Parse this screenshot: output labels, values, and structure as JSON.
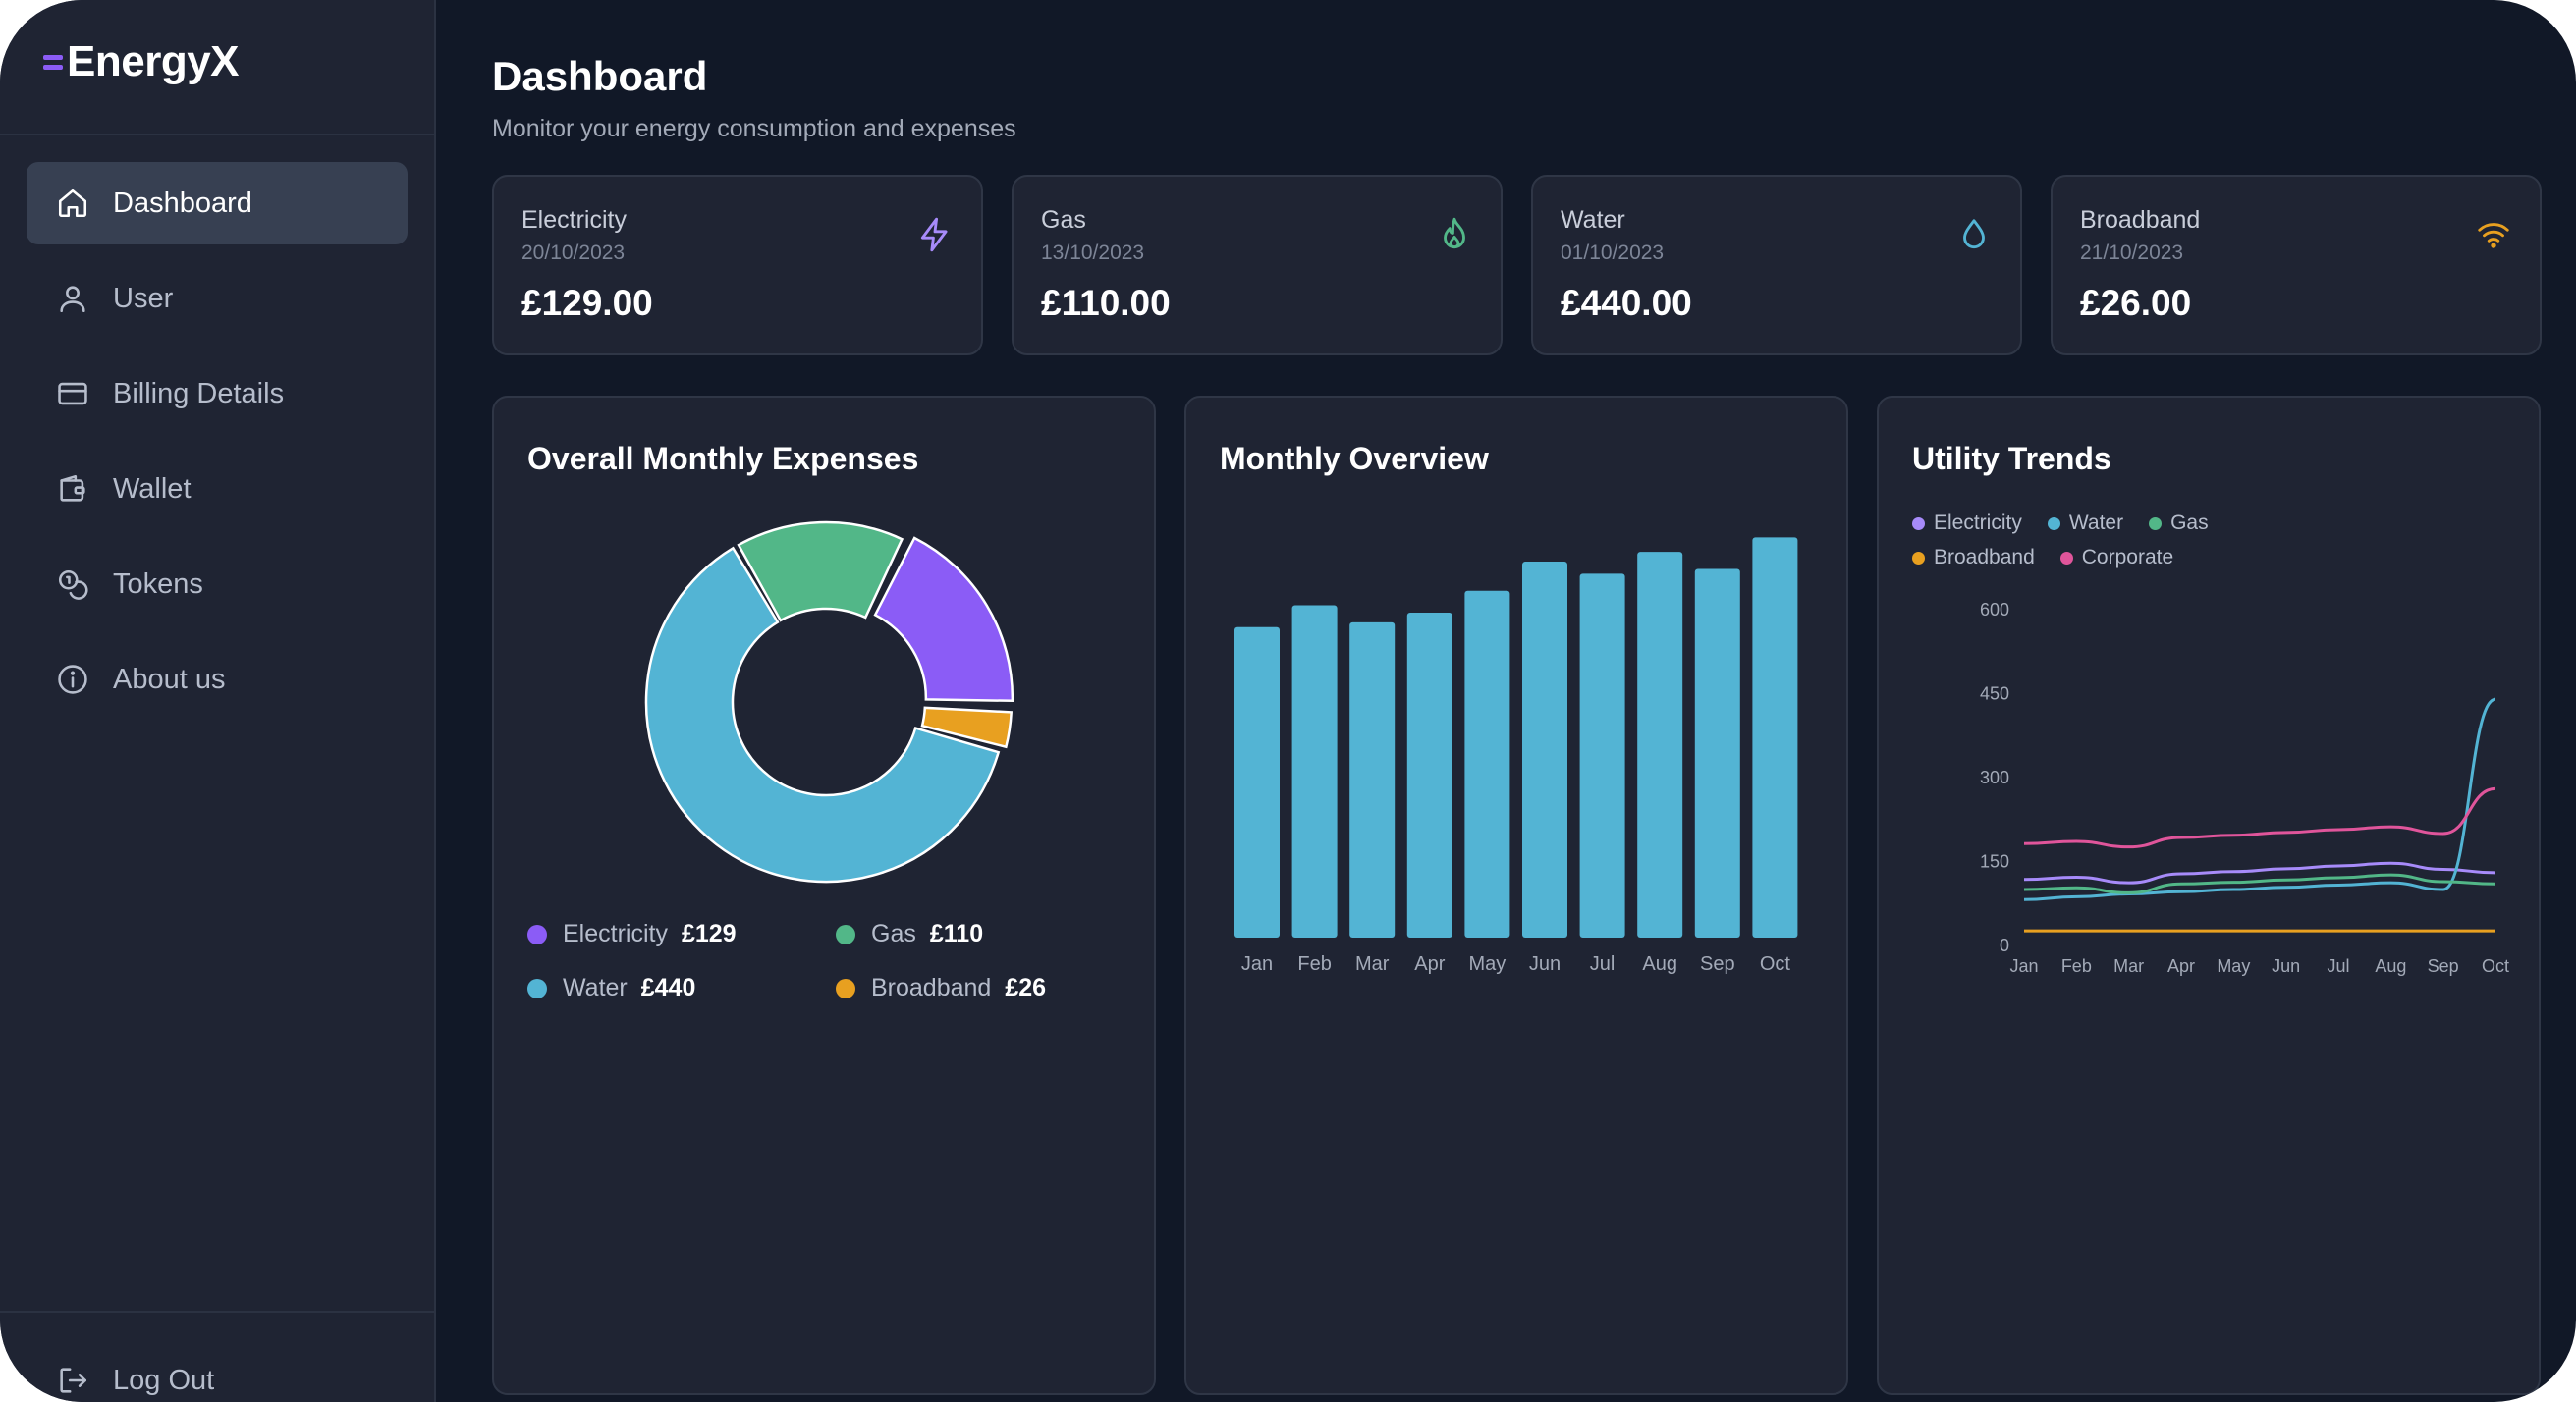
{
  "app": {
    "brand": "EnergyX"
  },
  "colors": {
    "electricity": "#8b5cf6",
    "water": "#53b4d4",
    "gas": "#52b788",
    "broadband": "#e8a020",
    "corporate": "#e0559b",
    "bar": "#53b4d4",
    "background": "#111827",
    "panel": "#1f2433"
  },
  "sidebar": {
    "items": [
      {
        "label": "Dashboard",
        "icon": "home-icon",
        "active": true
      },
      {
        "label": "User",
        "icon": "user-icon",
        "active": false
      },
      {
        "label": "Billing Details",
        "icon": "credit-card-icon",
        "active": false
      },
      {
        "label": "Wallet",
        "icon": "wallet-icon",
        "active": false
      },
      {
        "label": "Tokens",
        "icon": "coins-icon",
        "active": false
      },
      {
        "label": "About us",
        "icon": "info-icon",
        "active": false
      }
    ],
    "logout": {
      "label": "Log Out",
      "icon": "logout-icon"
    }
  },
  "header": {
    "title": "Dashboard",
    "subtitle": "Monitor your energy consumption and expenses"
  },
  "cards": [
    {
      "label": "Electricity",
      "date": "20/10/2023",
      "amount": "£129.00",
      "icon": "lightning-icon"
    },
    {
      "label": "Gas",
      "date": "13/10/2023",
      "amount": "£110.00",
      "icon": "flame-icon"
    },
    {
      "label": "Water",
      "date": "01/10/2023",
      "amount": "£440.00",
      "icon": "droplet-icon"
    },
    {
      "label": "Broadband",
      "date": "21/10/2023",
      "amount": "£26.00",
      "icon": "wifi-icon"
    }
  ],
  "panels": {
    "expenses": {
      "title": "Overall Monthly Expenses"
    },
    "overview": {
      "title": "Monthly Overview"
    },
    "trends": {
      "title": "Utility Trends"
    }
  },
  "chart_data": [
    {
      "type": "pie",
      "title": "Overall Monthly Expenses",
      "slices": [
        {
          "name": "Electricity",
          "value": 129,
          "display": "£129"
        },
        {
          "name": "Broadband",
          "value": 26,
          "display": "£26"
        },
        {
          "name": "Water",
          "value": 440,
          "display": "£440"
        },
        {
          "name": "Gas",
          "value": 110,
          "display": "£110"
        }
      ]
    },
    {
      "type": "bar",
      "title": "Monthly Overview",
      "categories": [
        "Jan",
        "Feb",
        "Mar",
        "Apr",
        "May",
        "Jun",
        "Jul",
        "Aug",
        "Sep",
        "Oct"
      ],
      "values": [
        640,
        685,
        650,
        670,
        715,
        775,
        750,
        795,
        760,
        825
      ],
      "ylim": [
        0,
        850
      ],
      "grid": false
    },
    {
      "type": "line",
      "title": "Utility Trends",
      "legend": "top-left",
      "x": [
        "Jan",
        "Feb",
        "Mar",
        "Apr",
        "May",
        "Jun",
        "Jul",
        "Aug",
        "Sep",
        "Oct"
      ],
      "yticks": [
        "0",
        "150",
        "300",
        "450",
        "600"
      ],
      "ylim": [
        0,
        600
      ],
      "series": [
        {
          "name": "Electricity",
          "values": [
            118,
            122,
            112,
            128,
            132,
            137,
            142,
            147,
            136,
            130
          ]
        },
        {
          "name": "Water",
          "values": [
            82,
            87,
            92,
            96,
            100,
            104,
            108,
            112,
            100,
            440
          ]
        },
        {
          "name": "Gas",
          "values": [
            100,
            103,
            94,
            110,
            113,
            117,
            121,
            126,
            114,
            110
          ]
        },
        {
          "name": "Broadband",
          "values": [
            26,
            26,
            26,
            26,
            26,
            26,
            26,
            26,
            26,
            26
          ]
        },
        {
          "name": "Corporate",
          "values": [
            182,
            186,
            176,
            193,
            197,
            202,
            207,
            212,
            200,
            280
          ]
        }
      ]
    }
  ]
}
